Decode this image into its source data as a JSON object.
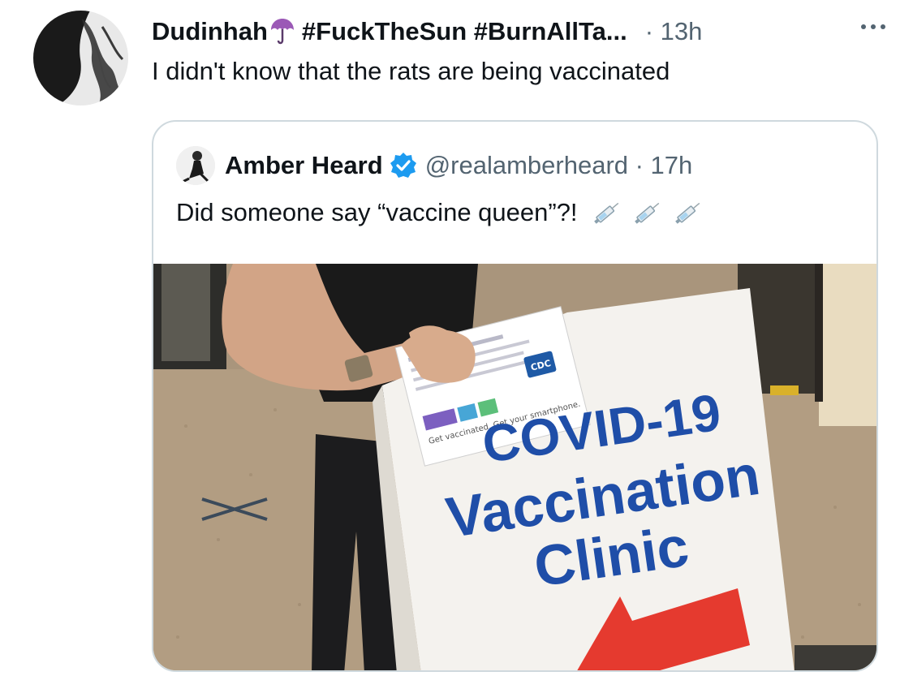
{
  "tweet": {
    "display_name": "Dudinhah",
    "name_emoji": "umbrella-emoji",
    "hashtags": "#FuckTheSun #BurnAllTa...",
    "time": "· 13h",
    "text": "I didn't know that the rats are being vaccinated",
    "more_icon": "more-icon"
  },
  "quoted_tweet": {
    "display_name": "Amber Heard",
    "verified_icon": "verified-badge-icon",
    "handle_time": "@realamberheard · 17h",
    "text": "Did someone say “vaccine queen”?!",
    "emojis": [
      "syringe-emoji",
      "syringe-emoji",
      "syringe-emoji"
    ],
    "photo": {
      "sign_line1": "COVID-19",
      "sign_line2": "Vaccination",
      "sign_line3": "Clinic",
      "card_text": "Get vaccinated. Get your smartphone.",
      "card_logo": "CDC"
    }
  },
  "colors": {
    "text": "#0f1419",
    "secondary": "#536471",
    "border": "#cfd9de",
    "verified": "#1d9bf0",
    "sign_text": "#1f4ea8",
    "arrow": "#e53a2f"
  }
}
